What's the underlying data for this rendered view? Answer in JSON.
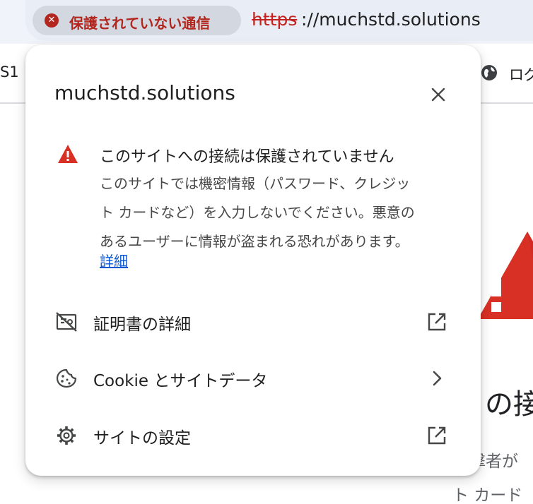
{
  "omnibox": {
    "security_chip_label": "保護されていない通信",
    "url_scheme": "https",
    "url_rest": "://muchstd.solutions"
  },
  "background_page": {
    "left_fragment": "S1",
    "login_fragment": "ログ",
    "heading_fragment": "の接",
    "body_fragment_1": "撃者が",
    "body_fragment_2": "ト カード"
  },
  "popup": {
    "title": "muchstd.solutions",
    "warning": {
      "heading": "このサイトへの接続は保護されていません",
      "body_lines": [
        "このサイトでは機密情報（パスワード、クレジッ",
        "ト カードなど）を入力しないでください。悪意の",
        "あるユーザーに情報が盗まれる恐れがあります。"
      ],
      "details_link": "詳細"
    },
    "menu": [
      {
        "label": "証明書の詳細",
        "icon": "certificate-icon",
        "trailing": "external-link-icon"
      },
      {
        "label": "Cookie とサイトデータ",
        "icon": "cookie-icon",
        "trailing": "chevron-right-icon"
      },
      {
        "label": "サイトの設定",
        "icon": "gear-icon",
        "trailing": "external-link-icon"
      }
    ]
  },
  "colors": {
    "danger_red": "#b3261e",
    "warning_red": "#d93025",
    "link_blue": "#0b57d0",
    "chip_bg": "#d3d8e0",
    "omnibox_bg": "#e9eef6"
  }
}
